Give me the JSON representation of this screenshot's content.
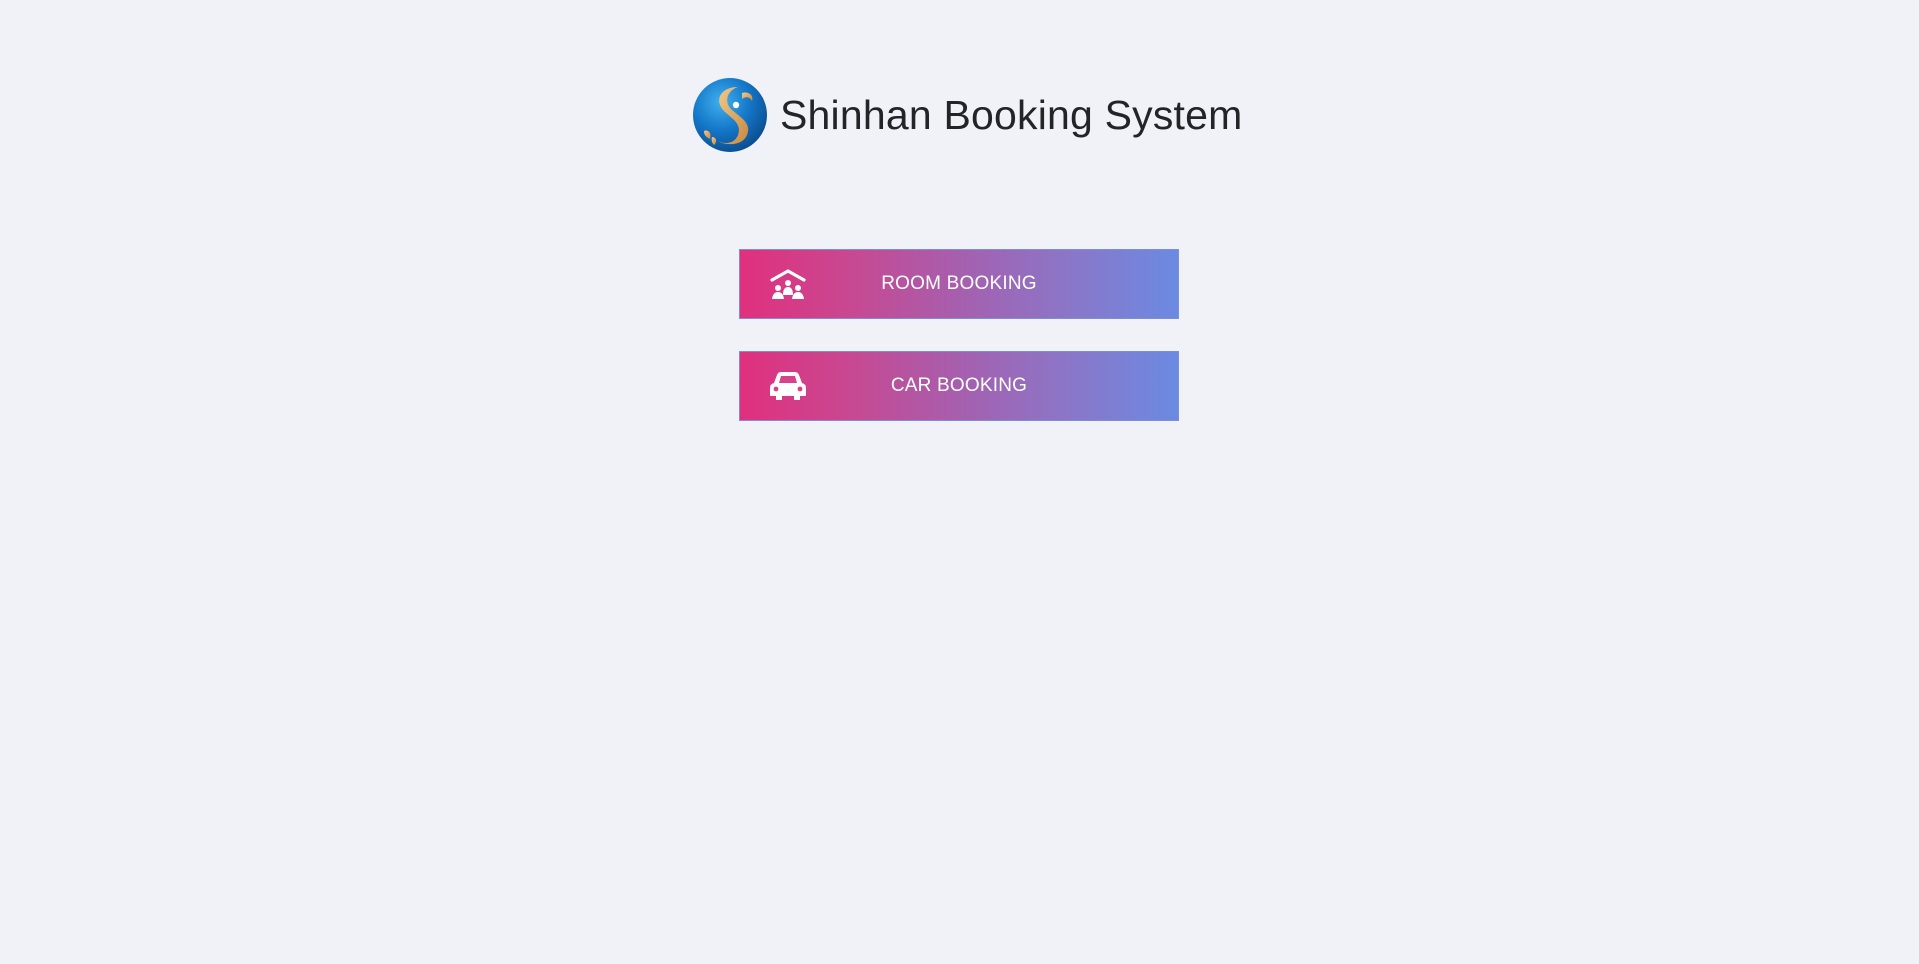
{
  "header": {
    "title": "Shinhan Booking System",
    "logo_icon": "shinhan-logo-icon"
  },
  "menu": [
    {
      "label": "ROOM BOOKING",
      "icon": "meeting-room-icon"
    },
    {
      "label": "CAR BOOKING",
      "icon": "car-icon"
    }
  ],
  "colors": {
    "background": "#f0f2f7",
    "gradient_start": "#e0307d",
    "gradient_end": "#6b8ae2",
    "text": "#222428"
  }
}
